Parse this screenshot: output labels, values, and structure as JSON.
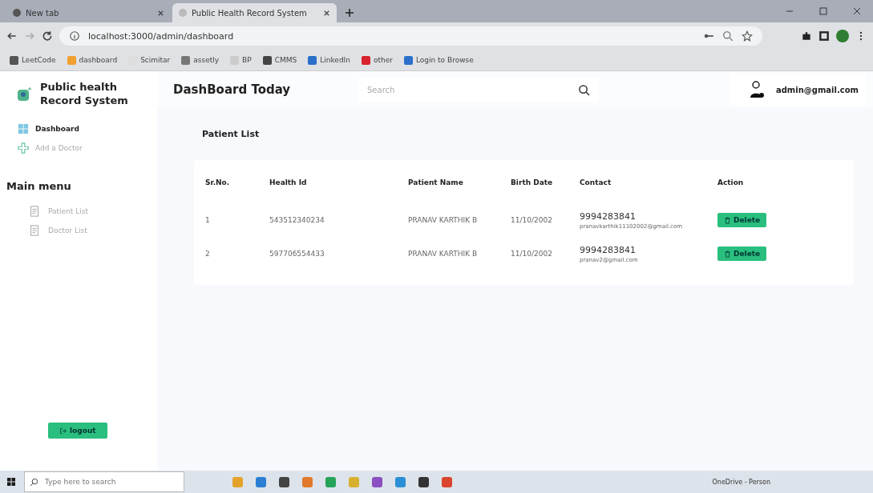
{
  "browser": {
    "tabs": [
      {
        "title": "New tab",
        "selected": false
      },
      {
        "title": "Public Health Record System",
        "selected": true
      }
    ],
    "address": "localhost:3000/admin/dashboard",
    "bookmarks": [
      {
        "label": "LeetCode",
        "color": "#555555"
      },
      {
        "label": "dashboard",
        "color": "#f0a030"
      },
      {
        "label": "Scimitar",
        "color": "#dddddd"
      },
      {
        "label": "assetly",
        "color": "#777777"
      },
      {
        "label": "BP",
        "color": "#cccccc"
      },
      {
        "label": "CMMS",
        "color": "#444444"
      },
      {
        "label": "LinkedIn",
        "color": "#2a6fc9"
      },
      {
        "label": "other",
        "color": "#d9232e"
      },
      {
        "label": "Login to Browse",
        "color": "#2a6fc9"
      }
    ]
  },
  "sidebar": {
    "brand": "Public health Record System",
    "items": [
      {
        "label": "Dashboard",
        "selected": true
      },
      {
        "label": "Add a Doctor",
        "selected": false
      }
    ],
    "section": "Main menu",
    "menu": [
      {
        "label": "Patient List"
      },
      {
        "label": "Doctor List"
      }
    ],
    "logout": "logout"
  },
  "header": {
    "title": "DashBoard Today",
    "search": {
      "placeholder": "Search"
    },
    "user": "admin@gmail.com"
  },
  "table": {
    "title": "Patient List",
    "columns": [
      "Sr.No.",
      "Health Id",
      "Patient Name",
      "Birth Date",
      "Contact",
      "Action"
    ],
    "rows": [
      {
        "sr": "1",
        "health_id": "543512340234",
        "name": "PRANAV KARTHIK B",
        "birth": "11/10/2002",
        "phone": "9994283841",
        "email": "pranavkarthik11102002@gmail.com",
        "action": "Delete"
      },
      {
        "sr": "2",
        "health_id": "597706554433",
        "name": "PRANAV KARTHIK B",
        "birth": "11/10/2002",
        "phone": "9994283841",
        "email": "pranav2@gmail.com",
        "action": "Delete"
      }
    ]
  },
  "taskbar": {
    "search": {
      "placeholder": "Type here to search"
    },
    "tray": "OneDrive - Person"
  }
}
